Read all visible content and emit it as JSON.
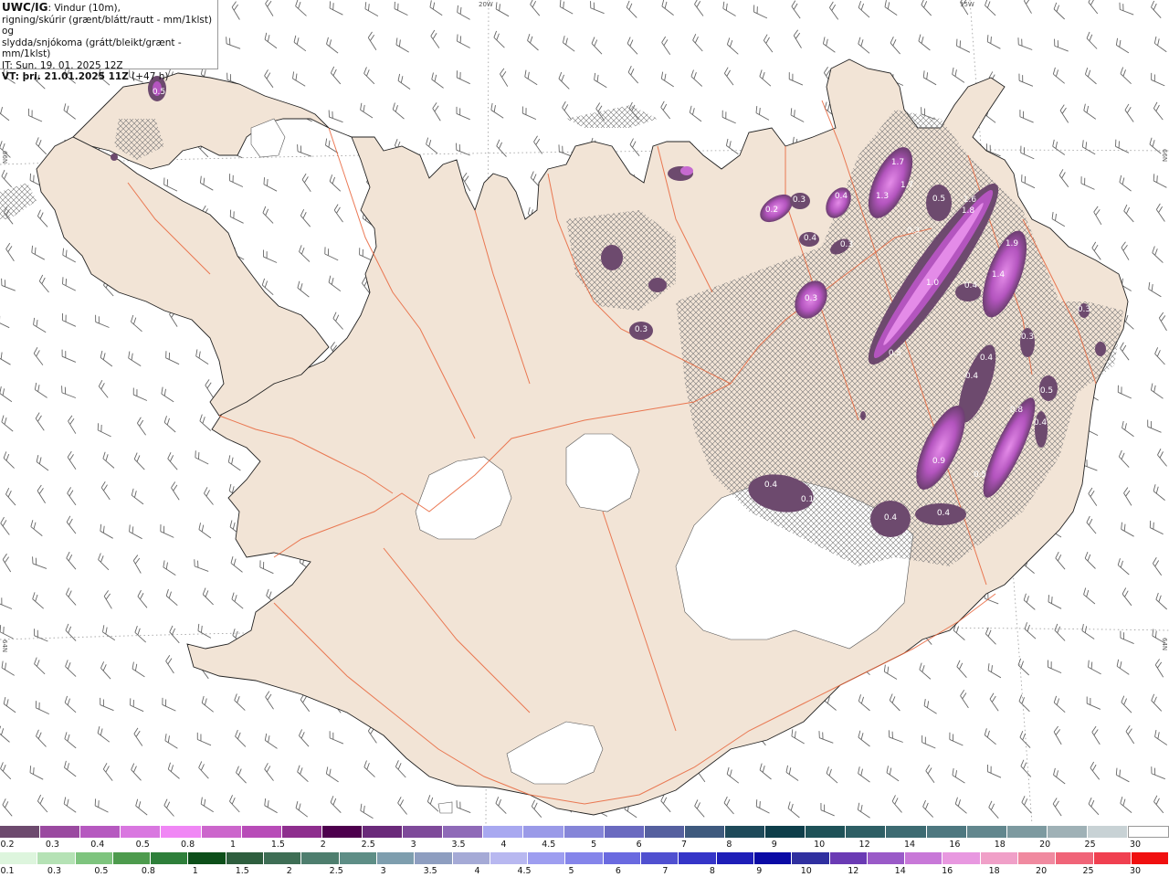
{
  "header": {
    "title": "UWC/IG",
    "line1_rest": ": Vindur (10m),",
    "line2": "rigning/skúrir (grænt/blátt/rautt - mm/1klst) og",
    "line3": "slydda/snjókoma (grátt/bleikt/grænt - mm/1klst)",
    "it": "IT: Sun. 19. 01. 2025 12Z",
    "vt": "VT: þri. 21.01.2025 11Z",
    "vt_lead": "(+47 h)"
  },
  "grid_labels": {
    "lon_20w": "20W",
    "lon_15w": "15W",
    "lat_66n_left": "66N",
    "lat_66n_right": "66N",
    "lat_64n_left": "64N",
    "lat_64n_right": "64N"
  },
  "precip_labels": [
    "0.5",
    "1.7",
    "0.3",
    "0.4",
    "1.3",
    "1.7",
    "0.5",
    "1.6",
    "1.8",
    "0.2",
    "0.3",
    "0.4",
    "0.3",
    "1.9",
    "1.4",
    "0.4",
    "1.0",
    "0.3",
    "0.5",
    "0.3",
    "0.4",
    "0.4",
    "0.4",
    "0.3",
    "0.8",
    "0.4",
    "0.5",
    "0.9",
    "0.5",
    "0.3",
    "0.1",
    "0.4",
    "0.4"
  ],
  "legend": {
    "snow_colors": [
      "#6d4a6e",
      "#9a4aa0",
      "#b659c0",
      "#d977e0",
      "#f087f5",
      "#cc66cc",
      "#b84cb8",
      "#8e2e8e",
      "#4d004d",
      "#6a2a7a",
      "#7e4a9a",
      "#8f6ab8",
      "#a8a8f0",
      "#9a9ae8",
      "#8585d8",
      "#6a6ac0",
      "#55609f",
      "#3e5a7e",
      "#1e4a5a",
      "#0e3e4a",
      "#1e5258",
      "#2e5f65",
      "#3d6b72",
      "#4e7880",
      "#62878e",
      "#7d9aa0",
      "#9fb1b6",
      "#c8d2d5",
      "#ffffff"
    ],
    "snow_labels": [
      "0.2",
      "0.3",
      "0.4",
      "0.5",
      "0.8",
      "1",
      "1.5",
      "2",
      "2.5",
      "3",
      "3.5",
      "4",
      "4.5",
      "5",
      "6",
      "7",
      "8",
      "9",
      "10",
      "12",
      "14",
      "16",
      "18",
      "20",
      "25",
      "30"
    ],
    "rain_colors": [
      "#ddf5dd",
      "#b5e2b5",
      "#7ec47e",
      "#4d9b4d",
      "#2e7f3a",
      "#0d4f1a",
      "#2e5e3e",
      "#3e6e55",
      "#4e7e6e",
      "#5e8e86",
      "#7e9eae",
      "#8e9ec0",
      "#a5aad6",
      "#b8b8f0",
      "#9e9ef0",
      "#8585ea",
      "#6a6ae0",
      "#5050d0",
      "#3535c8",
      "#1e1eb8",
      "#0a0aa5",
      "#3030a0",
      "#6a3ab4",
      "#9a5ac8",
      "#c878d8",
      "#e898e0",
      "#f0a0c8",
      "#f08aa0",
      "#f06478",
      "#f04050",
      "#f01010"
    ],
    "rain_labels": [
      "0.1",
      "0.3",
      "0.5",
      "0.8",
      "1",
      "1.5",
      "2",
      "2.5",
      "3",
      "3.5",
      "4",
      "4.5",
      "5",
      "6",
      "7",
      "8",
      "9",
      "10",
      "12",
      "14",
      "16",
      "18",
      "20",
      "25",
      "30"
    ]
  }
}
